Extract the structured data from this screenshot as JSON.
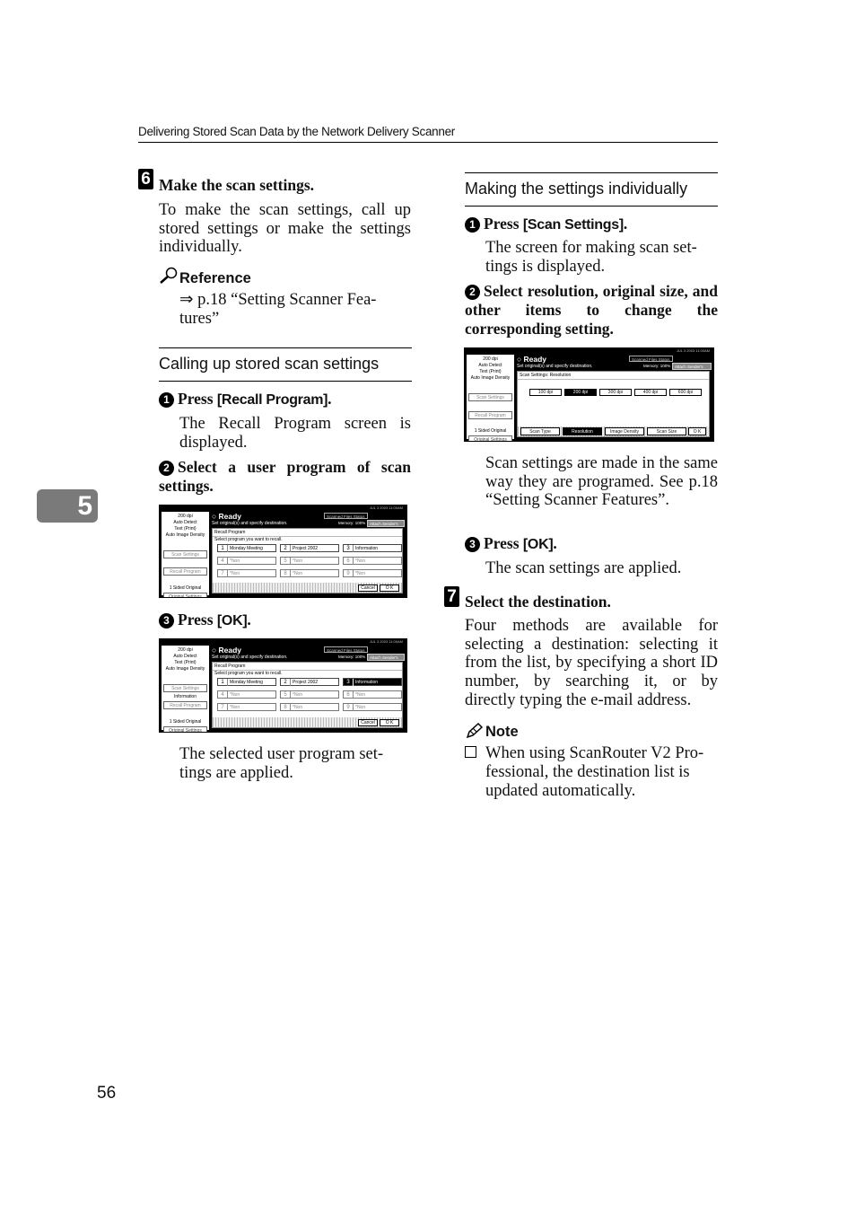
{
  "header": {
    "running_title": "Delivering Stored Scan Data by the Network Delivery Scanner"
  },
  "chapter_tab": "5",
  "page_number": "56",
  "step6": {
    "number": "6",
    "title": "Make the scan settings.",
    "body": "To make the scan settings, call up stored settings or make the settings individually.",
    "reference": {
      "label": "Reference",
      "icon": "magnifier-icon",
      "text_line1": "⇒ p.18 “Setting Scanner Fea-",
      "text_line2": "tures”"
    }
  },
  "section_calling": {
    "title": "Calling up stored scan settings",
    "sub1": {
      "num": "1",
      "prefix": "Press ",
      "key": "[Recall Program]",
      "suffix": ".",
      "body": "The Recall Program screen is displayed."
    },
    "sub2": {
      "num": "2",
      "text": "Select a user program of scan settings."
    },
    "sub3": {
      "num": "3",
      "prefix": "Press ",
      "key": "[OK]",
      "suffix": ".",
      "body": "The selected user program settings are applied.",
      "body_line1": "The selected user program set-",
      "body_line2": "tings are applied."
    }
  },
  "section_individual": {
    "title": "Making the settings individually",
    "sub1": {
      "num": "1",
      "prefix": "Press ",
      "key": "[Scan Settings]",
      "suffix": ".",
      "body_line1": "The screen for making scan set-",
      "body_line2": "tings is displayed."
    },
    "sub2": {
      "num": "2",
      "text": "Select resolution, original size, and other items to change the corresponding setting."
    },
    "after_screen": "Scan settings are made in the same way they are programed. See p.18 “Setting Scanner Features”.",
    "sub3": {
      "num": "3",
      "prefix": "Press ",
      "key": "[OK]",
      "suffix": ".",
      "body": "The scan settings are applied."
    }
  },
  "step7": {
    "number": "7",
    "title": "Select the destination.",
    "body": "Four methods are available for selecting a destination: selecting it from the list, by specifying a short ID number, by searching it, or by directly typing the e-mail address.",
    "note": {
      "label": "Note",
      "icon": "pencil-icon",
      "bullet_icon": "checkbox-icon",
      "item_line1": "When using ScanRouter V2 Pro-",
      "item_line2": "fessional, the destination list is",
      "item_line3": "updated automatically."
    }
  },
  "screen_common": {
    "info_lines": [
      "200 dpi",
      "Auto Detect",
      "Text (Print)",
      "Auto Image Density"
    ],
    "scan_settings_btn": "Scan Settings",
    "recall_program_btn": "Recall Program",
    "information_label": "Information",
    "sided_original": "1 Sided Original",
    "original_settings_btn": "Original Settings",
    "ready": "Ready",
    "status_btn": "Scanned Files Status",
    "memory": "Memory: 100%",
    "attach_btn": "Attach Sender's Name",
    "clock": "JUL  3 2003 11:00AM",
    "cancel": "Cancel",
    "ok": "O K"
  },
  "screen_recall": {
    "subtitle": "Set original(s) and specify destination.",
    "panel_title": "Recall Program",
    "panel_sub": "Select program you want to recall.",
    "programs": [
      {
        "n": "1",
        "name": "Monday Meeting"
      },
      {
        "n": "2",
        "name": "Project 2002"
      },
      {
        "n": "3",
        "name": "Information"
      },
      {
        "n": "4",
        "name": "*Non"
      },
      {
        "n": "5",
        "name": "*Non"
      },
      {
        "n": "6",
        "name": "*Non"
      },
      {
        "n": "7",
        "name": "*Non"
      },
      {
        "n": "8",
        "name": "*Non"
      },
      {
        "n": "9",
        "name": "*Non"
      }
    ],
    "selected_in_second": "3"
  },
  "screen_scan": {
    "subtitle": "Set original(s) and specify destination.",
    "panel_title": "Scan Settings: Resolution",
    "resolutions": [
      "100 dpi",
      "200 dpi",
      "300 dpi",
      "400 dpi",
      "600 dpi"
    ],
    "selected_resolution": "200 dpi",
    "tabs": [
      "Scan Type",
      "Resolution",
      "Image Density",
      "Scan Size"
    ],
    "selected_tab": "Resolution"
  }
}
